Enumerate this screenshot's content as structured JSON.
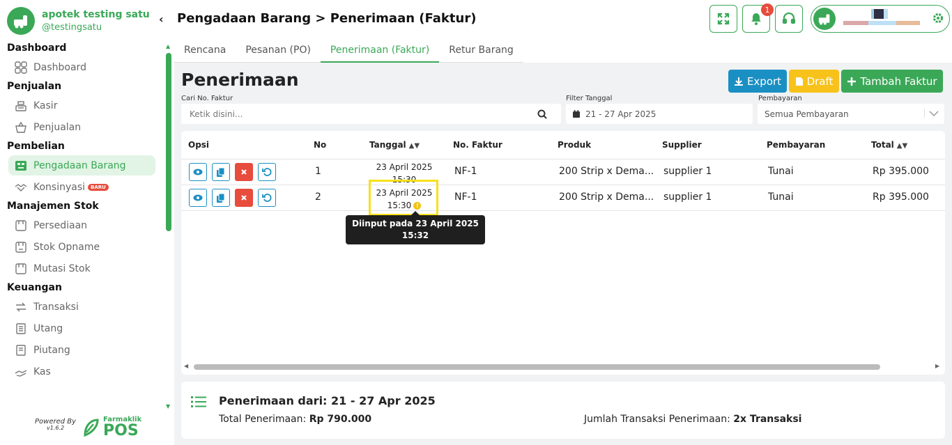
{
  "brand": {
    "name": "apotek testing satu",
    "user": "@testingsatu"
  },
  "nav": {
    "sections": [
      {
        "title": "Dashboard",
        "items": [
          {
            "label": "Dashboard",
            "icon": "grid-icon"
          }
        ]
      },
      {
        "title": "Penjualan",
        "items": [
          {
            "label": "Kasir",
            "icon": "cash-register-icon"
          },
          {
            "label": "Penjualan",
            "icon": "basket-icon"
          }
        ]
      },
      {
        "title": "Pembelian",
        "items": [
          {
            "label": "Pengadaan Barang",
            "icon": "truck-box-icon",
            "active": true
          },
          {
            "label": "Konsinyasi",
            "icon": "handshake-icon",
            "badge": "BARU"
          }
        ]
      },
      {
        "title": "Manajemen Stok",
        "items": [
          {
            "label": "Persediaan",
            "icon": "box-icon"
          },
          {
            "label": "Stok Opname",
            "icon": "clipboard-icon"
          },
          {
            "label": "Mutasi Stok",
            "icon": "transfer-box-icon"
          }
        ]
      },
      {
        "title": "Keuangan",
        "items": [
          {
            "label": "Transaksi",
            "icon": "exchange-icon"
          },
          {
            "label": "Utang",
            "icon": "ledger-icon"
          },
          {
            "label": "Piutang",
            "icon": "receipt-icon"
          },
          {
            "label": "Kas",
            "icon": "cash-hand-icon"
          }
        ]
      }
    ]
  },
  "footer": {
    "powered": "Powered By",
    "version": "v1.6.2",
    "brand_top": "Farmaklik",
    "brand_bottom": "POS"
  },
  "header": {
    "title": "Pengadaan Barang > Penerimaan (Faktur)",
    "notification_count": "1"
  },
  "tabs": [
    "Rencana",
    "Pesanan (PO)",
    "Penerimaan (Faktur)",
    "Retur Barang"
  ],
  "active_tab": "Penerimaan (Faktur)",
  "page": {
    "title": "Penerimaan",
    "buttons": {
      "export": "Export",
      "draft": "Draft",
      "add": "Tambah Faktur"
    },
    "filters": {
      "search_label": "Cari No. Faktur",
      "search_placeholder": "Ketik disini...",
      "date_label": "Filter Tanggal",
      "date_value": "21 - 27 Apr 2025",
      "payment_label": "Pembayaran",
      "payment_value": "Semua Pembayaran"
    }
  },
  "table": {
    "columns": [
      "Opsi",
      "No",
      "Tanggal",
      "No. Faktur",
      "Produk",
      "Supplier",
      "Pembayaran",
      "Total"
    ],
    "rows": [
      {
        "no": "1",
        "date": "23 April 2025",
        "time": "15:30",
        "invoice": "NF-1",
        "product": "200 Strip x Dema...",
        "supplier": "supplier 1",
        "payment": "Tunai",
        "total": "Rp 395.000"
      },
      {
        "no": "2",
        "date": "23 April 2025",
        "time": "15:30",
        "invoice": "NF-1",
        "product": "200 Strip x Dema...",
        "supplier": "supplier 1",
        "payment": "Tunai",
        "total": "Rp 395.000"
      }
    ],
    "tooltip": {
      "line1": "Diinput pada 23 April 2025",
      "line2": "15:32"
    }
  },
  "summary": {
    "title": "Penerimaan dari: 21 - 27 Apr 2025",
    "total_label": "Total Penerimaan:",
    "total_value": "Rp 790.000",
    "count_label": "Jumlah Transaksi Penerimaan:",
    "count_value": "2x Transaksi"
  },
  "colors": {
    "primary": "#3aa857",
    "export": "#1a8fc3",
    "draft": "#f7c21a",
    "danger": "#e74c3c",
    "highlight": "#f7e11a"
  }
}
